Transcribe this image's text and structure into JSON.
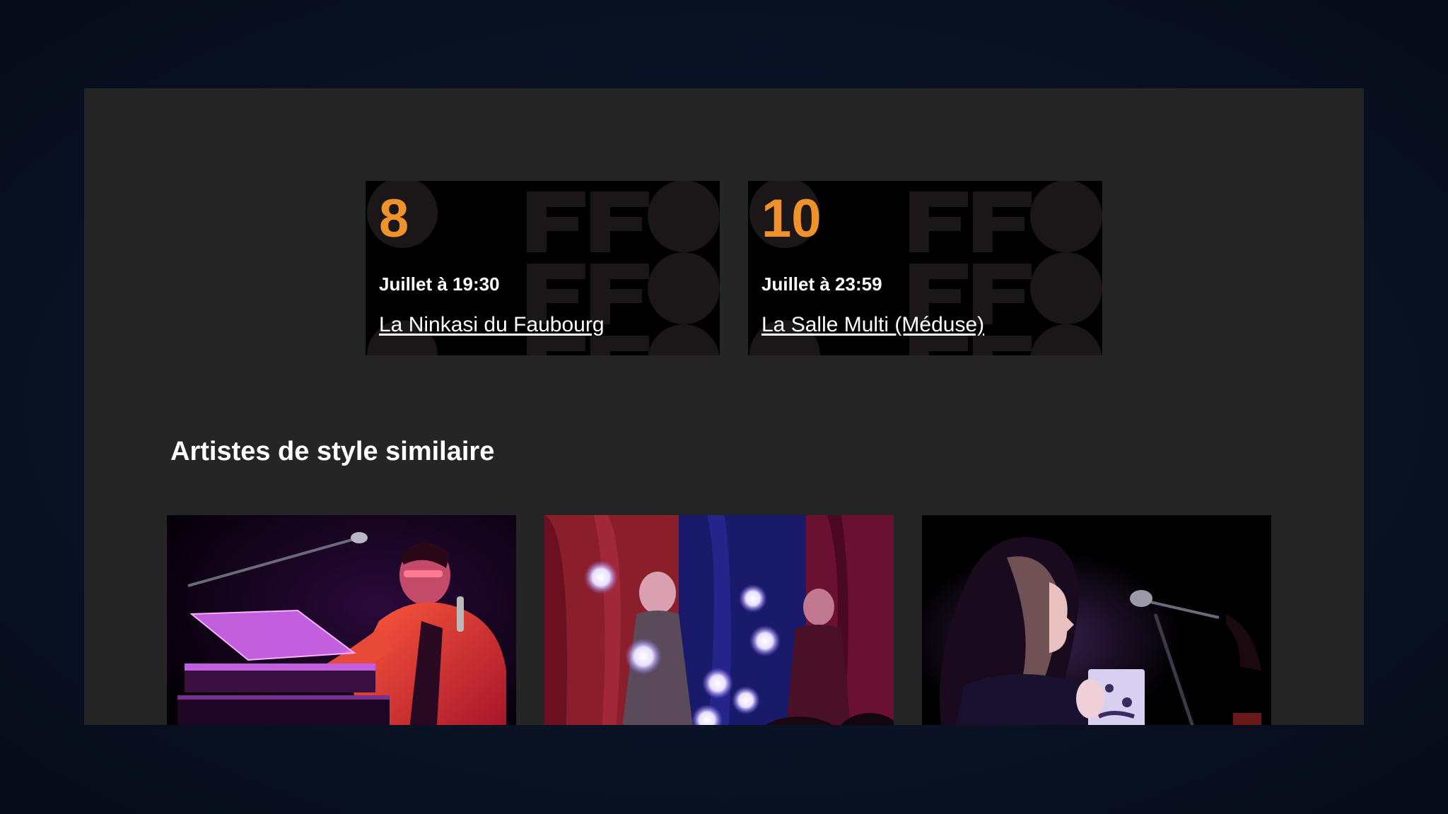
{
  "events": [
    {
      "day": "8",
      "when": "Juillet à 19:30",
      "venue": "La Ninkasi du Faubourg"
    },
    {
      "day": "10",
      "when": "Juillet à 23:59",
      "venue": "La Salle Multi (Méduse)"
    }
  ],
  "similar_section": {
    "title": "Artistes de style similaire"
  },
  "colors": {
    "accent": "#f0922b",
    "panel": "#252525",
    "card": "#000000",
    "pattern": "#1b1718"
  }
}
